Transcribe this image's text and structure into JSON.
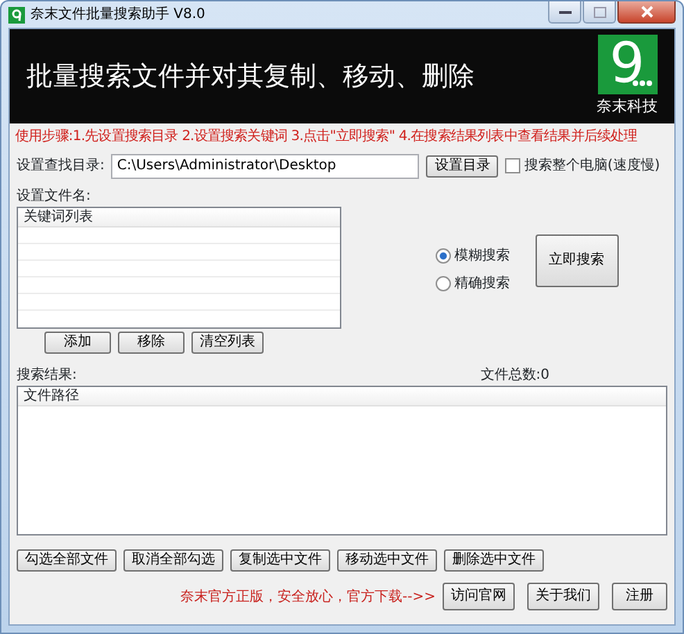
{
  "window": {
    "title": "奈末文件批量搜索助手 V8.0"
  },
  "banner": {
    "headline": "批量搜索文件并对其复制、移动、删除",
    "logo_text": "9",
    "logo_caption": "奈末科技"
  },
  "steps": "使用步骤:1.先设置搜索目录 2.设置搜索关键词 3.点击\"立即搜索\" 4.在搜索结果列表中查看结果并后续处理",
  "directory": {
    "label": "设置查找目录:",
    "value": "C:\\Users\\Administrator\\Desktop",
    "button": "设置目录",
    "whole_pc": {
      "label": "搜索整个电脑(速度慢)",
      "checked": false
    }
  },
  "keywords": {
    "label": "设置文件名:",
    "column": "关键词列表",
    "buttons": [
      "添加",
      "移除",
      "清空列表"
    ]
  },
  "search_mode": [
    {
      "label": "模糊搜索",
      "selected": true
    },
    {
      "label": "精确搜索",
      "selected": false
    }
  ],
  "search_button": "立即搜索",
  "results": {
    "label": "搜索结果:",
    "count": "文件总数:0",
    "column": "文件路径"
  },
  "actions": [
    "勾选全部文件",
    "取消全部勾选",
    "复制选中文件",
    "移动选中文件",
    "删除选中文件"
  ],
  "footer": {
    "notice": "奈末官方正版，安全放心，官方下载-->>",
    "buttons": [
      "访问官网",
      "关于我们",
      "注册"
    ]
  }
}
